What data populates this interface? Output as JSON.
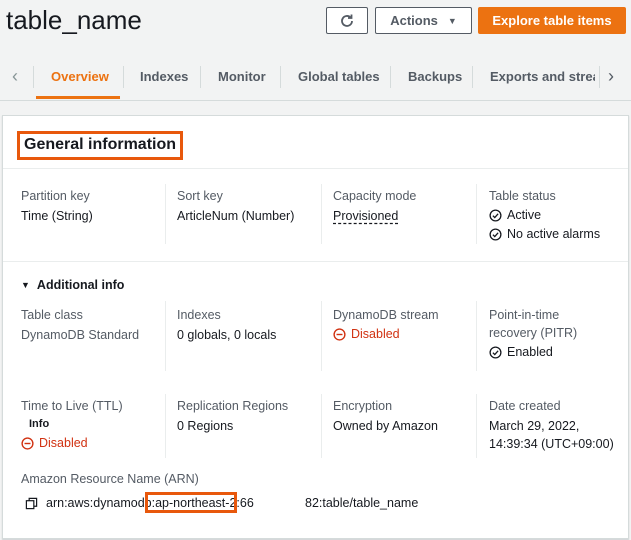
{
  "header": {
    "title": "table_name",
    "actions_label": "Actions",
    "explore_label": "Explore table items"
  },
  "tabs": [
    {
      "label": "Overview"
    },
    {
      "label": "Indexes"
    },
    {
      "label": "Monitor"
    },
    {
      "label": "Global tables"
    },
    {
      "label": "Backups"
    },
    {
      "label": "Exports and stream"
    }
  ],
  "general": {
    "title": "General information",
    "partition_key_label": "Partition key",
    "partition_key_value": "Time (String)",
    "sort_key_label": "Sort key",
    "sort_key_value": "ArticleNum (Number)",
    "capacity_mode_label": "Capacity mode",
    "capacity_mode_value": "Provisioned",
    "table_status_label": "Table status",
    "table_status_value": "Active",
    "alarms_value": "No active alarms"
  },
  "additional": {
    "toggle_label": "Additional info",
    "table_class_label": "Table class",
    "table_class_value": "DynamoDB Standard",
    "indexes_label": "Indexes",
    "indexes_value": "0 globals, 0 locals",
    "stream_label": "DynamoDB stream",
    "stream_value": "Disabled",
    "pitr_label_1": "Point-in-time",
    "pitr_label_2": "recovery (PITR)",
    "pitr_value": "Enabled",
    "ttl_label": "Time to Live (TTL)",
    "ttl_info": "Info",
    "ttl_value": "Disabled",
    "replication_label": "Replication Regions",
    "replication_value": "0 Regions",
    "encryption_label": "Encryption",
    "encryption_value": "Owned by Amazon",
    "date_created_label": "Date created",
    "date_created_line1": "March 29, 2022,",
    "date_created_line2": "14:39:34 (UTC+09:00)",
    "arn_label": "Amazon Resource Name (ARN)",
    "arn_prefix": "arn:aws:dynamodb:",
    "arn_region": "ap-northeast-2:",
    "arn_account_fragment": "66",
    "arn_suffix": "82:table/table_name"
  },
  "colors": {
    "accent": "#ec7211",
    "highlight_box": "#e8580c",
    "error": "#d13212",
    "success": "#16191f"
  }
}
